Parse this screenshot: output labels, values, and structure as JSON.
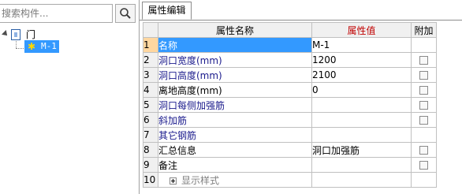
{
  "search": {
    "placeholder": "搜索构件..."
  },
  "tree": {
    "root_label": "门",
    "child_label": "M-1"
  },
  "tab": {
    "label": "属性编辑"
  },
  "grid": {
    "headers": {
      "index": "",
      "name": "属性名称",
      "value": "属性值",
      "attach": "附加"
    },
    "rows": [
      {
        "index": "1",
        "name": "名称",
        "value": "M-1",
        "checkbox": false
      },
      {
        "index": "2",
        "name": "洞口宽度(mm)",
        "value": "1200",
        "checkbox": true
      },
      {
        "index": "3",
        "name": "洞口高度(mm)",
        "value": "2100",
        "checkbox": true
      },
      {
        "index": "4",
        "name": "离地高度(mm)",
        "value": "0",
        "checkbox": true
      },
      {
        "index": "5",
        "name": "洞口每侧加强筋",
        "value": "",
        "checkbox": true
      },
      {
        "index": "6",
        "name": "斜加筋",
        "value": "",
        "checkbox": true
      },
      {
        "index": "7",
        "name": "其它钢筋",
        "value": "",
        "checkbox": false
      },
      {
        "index": "8",
        "name": "汇总信息",
        "value": "洞口加强筋",
        "checkbox": true
      },
      {
        "index": "9",
        "name": "备注",
        "value": "",
        "checkbox": true
      },
      {
        "index": "10",
        "name": "显示样式",
        "value": "",
        "checkbox": false
      }
    ]
  },
  "icons": {
    "search": "search-icon",
    "gear": "gear-icon",
    "expand": "plus-icon"
  },
  "colors": {
    "selection": "#3399ff",
    "value_header_text": "#c00000",
    "property_link": "#1a1a8c"
  }
}
